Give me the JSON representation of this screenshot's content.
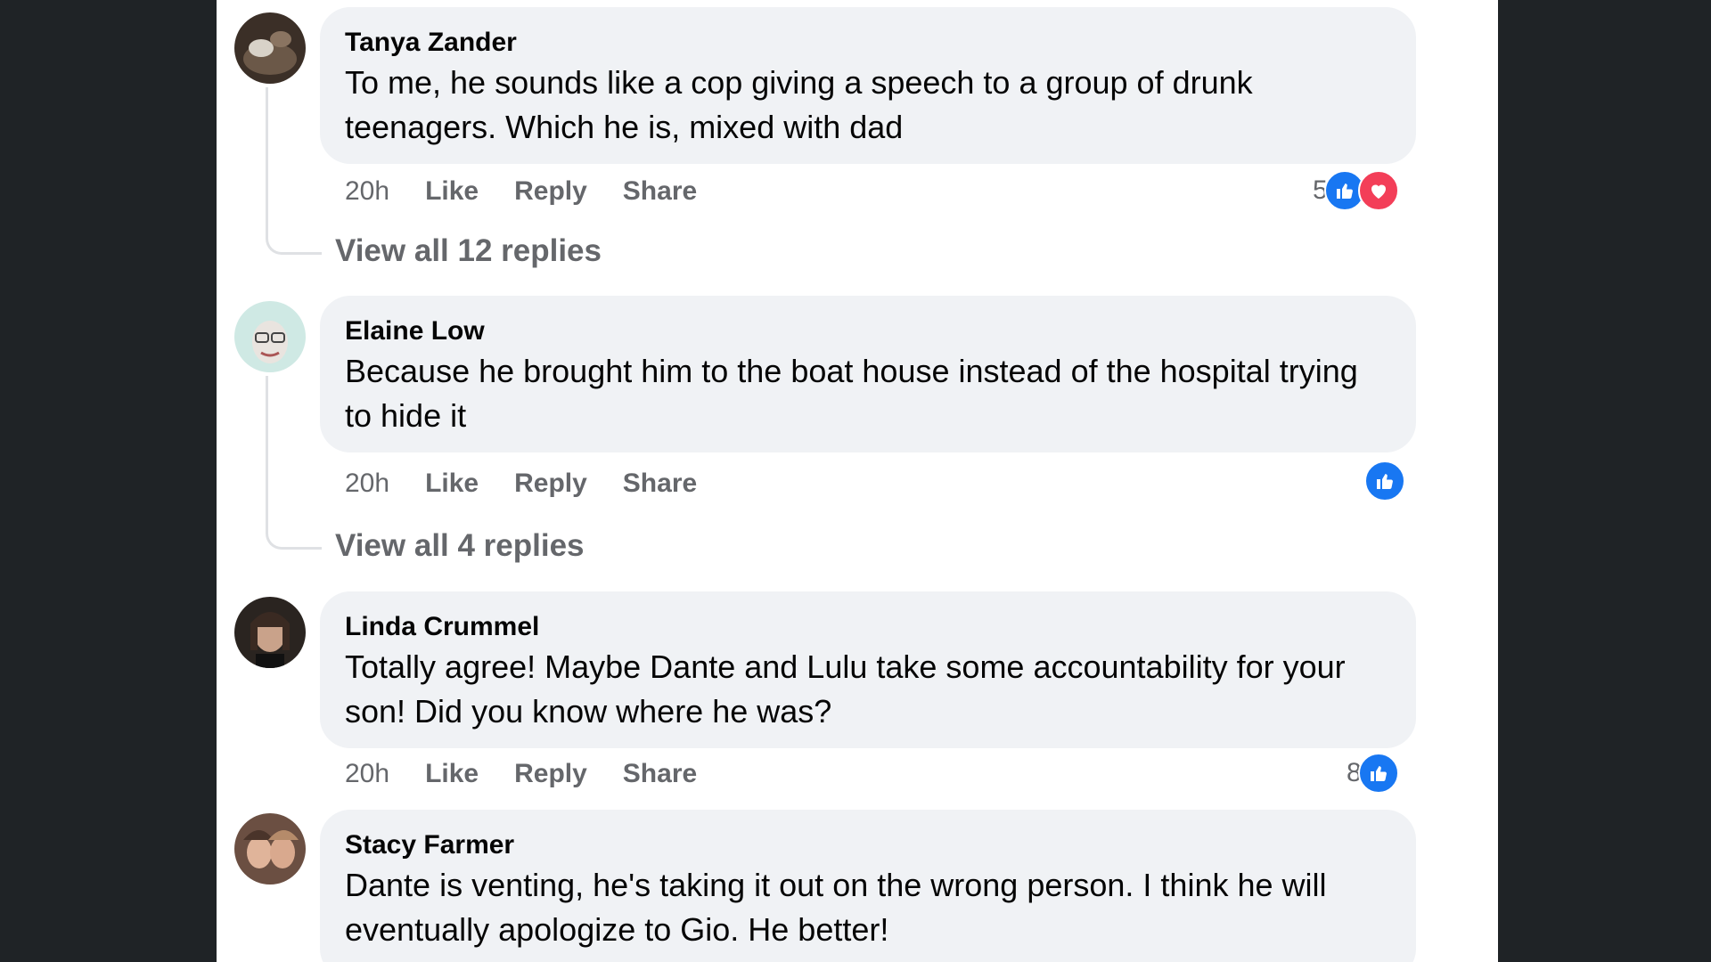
{
  "comments": [
    {
      "author": "Tanya Zander",
      "text": "To me, he sounds like a cop giving a speech to a group of drunk teenagers. Which he is, mixed with dad",
      "time": "20h",
      "like": "Like",
      "reply": "Reply",
      "share": "Share",
      "reaction_count": "5",
      "reactions": [
        "like-icon",
        "love-icon"
      ],
      "view_replies": "View all 12 replies",
      "avatar_color": "#5a4a3c"
    },
    {
      "author": "Elaine Low",
      "text": "Because he brought him to the boat house instead of the hospital trying to hide it",
      "time": "20h",
      "like": "Like",
      "reply": "Reply",
      "share": "Share",
      "reaction_count": "",
      "reactions": [
        "like-icon"
      ],
      "view_replies": "View all 4 replies",
      "avatar_color": "#cfe9e4"
    },
    {
      "author": "Linda Crummel",
      "text": "Totally agree! Maybe Dante and Lulu take some accountability for your son! Did you know where he was?",
      "time": "20h",
      "like": "Like",
      "reply": "Reply",
      "share": "Share",
      "reaction_count": "8",
      "reactions": [
        "like-icon"
      ],
      "avatar_color": "#3a2a22"
    },
    {
      "author": "Stacy Farmer",
      "text": "Dante is venting, he's taking it out on the wrong person. I think he will eventually apologize to Gio. He better!",
      "avatar_color": "#8a6a5a"
    }
  ],
  "colors": {
    "background": "#1f2326",
    "panel": "#ffffff",
    "bubble": "#f0f2f5",
    "like_blue": "#1877f2",
    "love_red": "#f33e58",
    "secondary_text": "#65676b"
  }
}
